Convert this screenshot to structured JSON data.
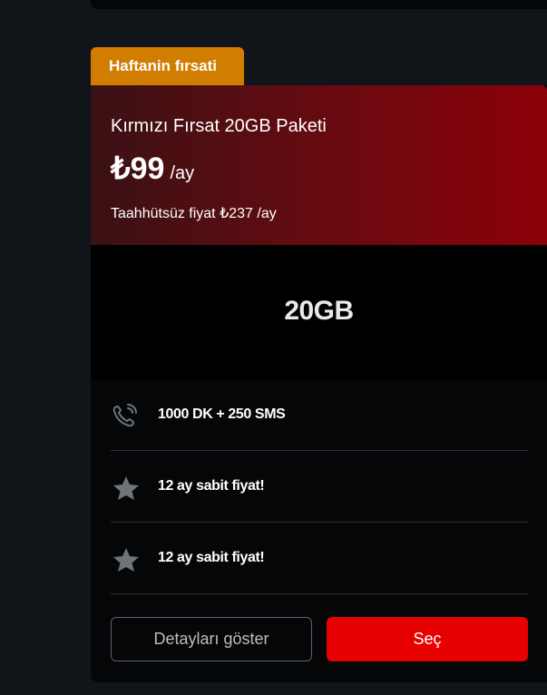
{
  "badge": {
    "label": "Haftanin fırsati"
  },
  "plan": {
    "name": "Kırmızı Fırsat 20GB Paketi",
    "price": "₺99",
    "price_period": "/ay",
    "no_commitment_price": "Taahhütsüz fiyat ₺237 /ay",
    "data_amount": "20GB"
  },
  "features": [
    {
      "icon": "phone-sms-icon",
      "text": "1000 DK + 250 SMS"
    },
    {
      "icon": "star-icon",
      "text": "12 ay sabit fiyat!"
    },
    {
      "icon": "star-icon",
      "text": "12 ay sabit fiyat!"
    }
  ],
  "actions": {
    "details_label": "Detayları göster",
    "select_label": "Seç"
  },
  "colors": {
    "badge": "#d17d00",
    "header_gradient_start": "#3a1114",
    "header_gradient_end": "#8c0008",
    "select_button": "#e60000",
    "card_background": "#050607"
  }
}
